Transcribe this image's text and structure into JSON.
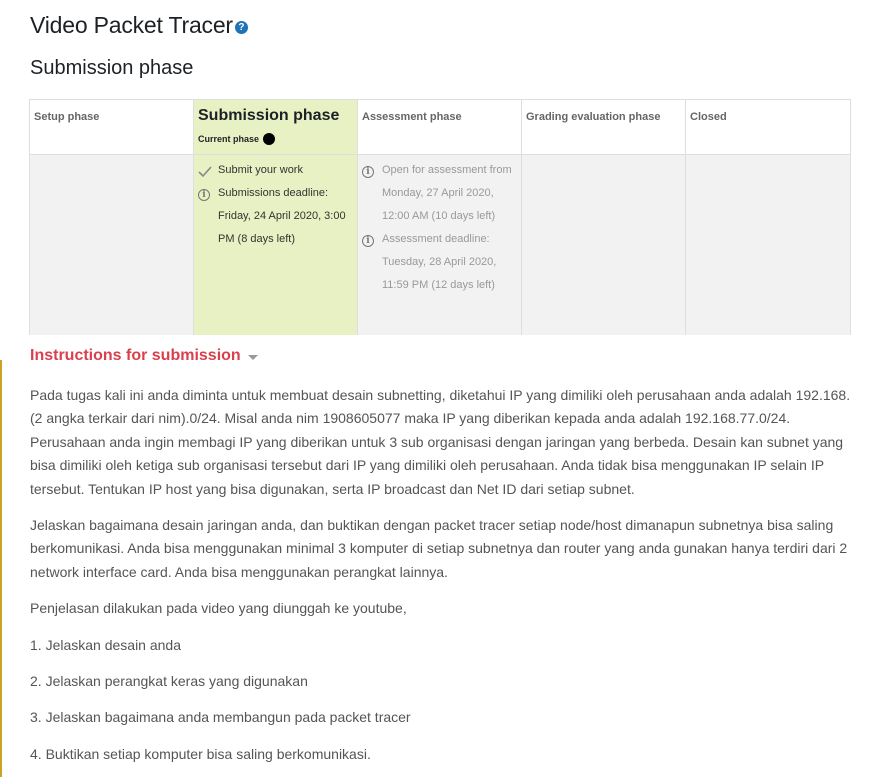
{
  "header": {
    "title": "Video Packet Tracer",
    "help_icon": "question-circle-icon"
  },
  "phase_heading": "Submission phase",
  "phases": [
    {
      "name": "Setup phase",
      "active": false,
      "tasks": []
    },
    {
      "name": "Submission phase",
      "active": true,
      "current_label": "Current phase",
      "tasks": [
        {
          "icon": "check-icon",
          "text": "Submit your work"
        },
        {
          "icon": "info-icon",
          "text": "Submissions deadline: Friday, 24 April 2020, 3:00 PM (8 days left)"
        }
      ]
    },
    {
      "name": "Assessment phase",
      "active": false,
      "tasks": [
        {
          "icon": "info-icon",
          "text": "Open for assessment from Monday, 27 April 2020, 12:00 AM (10 days left)"
        },
        {
          "icon": "info-icon",
          "text": "Assessment deadline: Tuesday, 28 April 2020, 11:59 PM (12 days left)"
        }
      ]
    },
    {
      "name": "Grading evaluation phase",
      "active": false,
      "tasks": []
    },
    {
      "name": "Closed",
      "active": false,
      "tasks": []
    }
  ],
  "instructions": {
    "title": "Instructions for submission",
    "paragraphs": [
      "Pada tugas kali ini anda diminta untuk membuat desain subnetting, diketahui IP yang dimiliki oleh perusahaan anda adalah 192.168.(2 angka terkair dari nim).0/24. Misal anda nim 1908605077 maka IP yang diberikan kepada anda adalah 192.168.77.0/24. Perusahaan anda ingin membagi IP yang diberikan untuk 3 sub organisasi dengan jaringan yang berbeda. Desain kan subnet yang bisa dimiliki oleh ketiga sub organisasi tersebut dari IP yang dimiliki oleh perusahaan. Anda tidak bisa menggunakan IP selain IP tersebut. Tentukan IP host yang bisa digunakan, serta IP broadcast dan Net ID dari setiap subnet.",
      "Jelaskan bagaimana desain jaringan anda, dan buktikan dengan packet tracer setiap node/host dimanapun subnetnya bisa saling berkomunikasi. Anda bisa menggunakan minimal 3 komputer di setiap subnetnya dan router yang anda gunakan hanya terdiri dari 2 network interface card. Anda bisa menggunakan perangkat lainnya.",
      "Penjelasan dilakukan pada video yang diunggah ke youtube,",
      "1. Jelaskan desain anda",
      "2. Jelaskan perangkat keras yang digunakan",
      "3. Jelaskan bagaimana anda membangun pada packet tracer",
      "4. Buktikan setiap komputer bisa saling berkomunikasi."
    ]
  },
  "colors": {
    "accent_red": "#d9404e",
    "active_phase_bg": "#e7f1c3",
    "inactive_phase_bg": "#f2f2f2",
    "help_icon_blue": "#1f73b7"
  }
}
